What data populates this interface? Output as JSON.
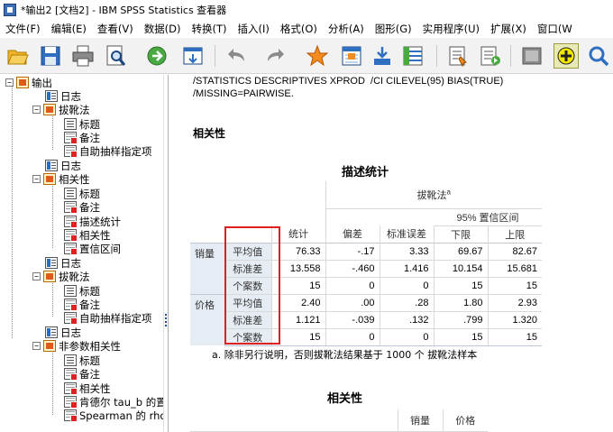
{
  "window": {
    "title": "*输出2 [文档2] - IBM SPSS Statistics 查看器"
  },
  "menu": [
    "文件(F)",
    "编辑(E)",
    "查看(V)",
    "数据(D)",
    "转换(T)",
    "插入(I)",
    "格式(O)",
    "分析(A)",
    "图形(G)",
    "实用程序(U)",
    "扩展(X)",
    "窗口(W"
  ],
  "toolbar": {
    "icons": [
      "open-icon",
      "save-icon",
      "print-icon",
      "print-preview-icon",
      "export-icon",
      "recall-dialog-icon",
      "undo-icon",
      "redo-icon",
      "goto-data-icon",
      "goto-case-icon",
      "goto-variable-icon",
      "variables-icon",
      "pivot-icon",
      "script-icon",
      "designate-window-icon",
      "find-icon"
    ]
  },
  "outline": {
    "root": "输出",
    "nodes": [
      {
        "label": "日志"
      },
      {
        "label": "拔靴法"
      },
      {
        "label": "标题"
      },
      {
        "label": "备注"
      },
      {
        "label": "自助抽样指定项"
      },
      {
        "label": "日志"
      },
      {
        "label": "相关性"
      },
      {
        "label": "标题"
      },
      {
        "label": "备注"
      },
      {
        "label": "描述统计"
      },
      {
        "label": "相关性"
      },
      {
        "label": "置信区间"
      },
      {
        "label": "日志"
      },
      {
        "label": "拔靴法"
      },
      {
        "label": "标题"
      },
      {
        "label": "备注"
      },
      {
        "label": "自助抽样指定项"
      },
      {
        "label": "日志"
      },
      {
        "label": "非参数相关性"
      },
      {
        "label": "标题"
      },
      {
        "label": "备注"
      },
      {
        "label": "相关性"
      },
      {
        "label": "肯德尔 tau_b 的置"
      },
      {
        "label": "Spearman 的 rho 的"
      }
    ]
  },
  "content": {
    "syntax_line1": "/STATISTICS DESCRIPTIVES XPROD  /CI CILEVEL(95) BIAS(TRUE)",
    "syntax_line2": "/MISSING=PAIRWISE.",
    "heading_corr": "相关性",
    "table_title": "描述统计",
    "bootstrap_header": "拔靴法",
    "bootstrap_sup": "a",
    "ci_header": "95% 置信区间",
    "col_headers": [
      "统计",
      "偏差",
      "标准误差",
      "下限",
      "上限"
    ],
    "rows": [
      {
        "var": "销量",
        "stat": "平均值",
        "values": [
          "76.33",
          "-.17",
          "3.33",
          "69.67",
          "82.67"
        ]
      },
      {
        "var": "",
        "stat": "标准差",
        "values": [
          "13.558",
          "-.460",
          "1.416",
          "10.154",
          "15.681"
        ]
      },
      {
        "var": "",
        "stat": "个案数",
        "values": [
          "15",
          "0",
          "0",
          "15",
          "15"
        ]
      },
      {
        "var": "价格",
        "stat": "平均值",
        "values": [
          "2.40",
          ".00",
          ".28",
          "1.80",
          "2.93"
        ]
      },
      {
        "var": "",
        "stat": "标准差",
        "values": [
          "1.121",
          "-.039",
          ".132",
          ".799",
          "1.320"
        ]
      },
      {
        "var": "",
        "stat": "个案数",
        "values": [
          "15",
          "0",
          "0",
          "15",
          "15"
        ]
      }
    ],
    "footnote": "a. 除非另行说明，否则拔靴法结果基于 1000 个 拔靴法样本",
    "heading_corr2": "相关性",
    "corr_cols": [
      "销量",
      "价格"
    ]
  },
  "colors": {
    "highlight_box": "#e02020",
    "label_cell_bg": "#e6ecf3"
  }
}
